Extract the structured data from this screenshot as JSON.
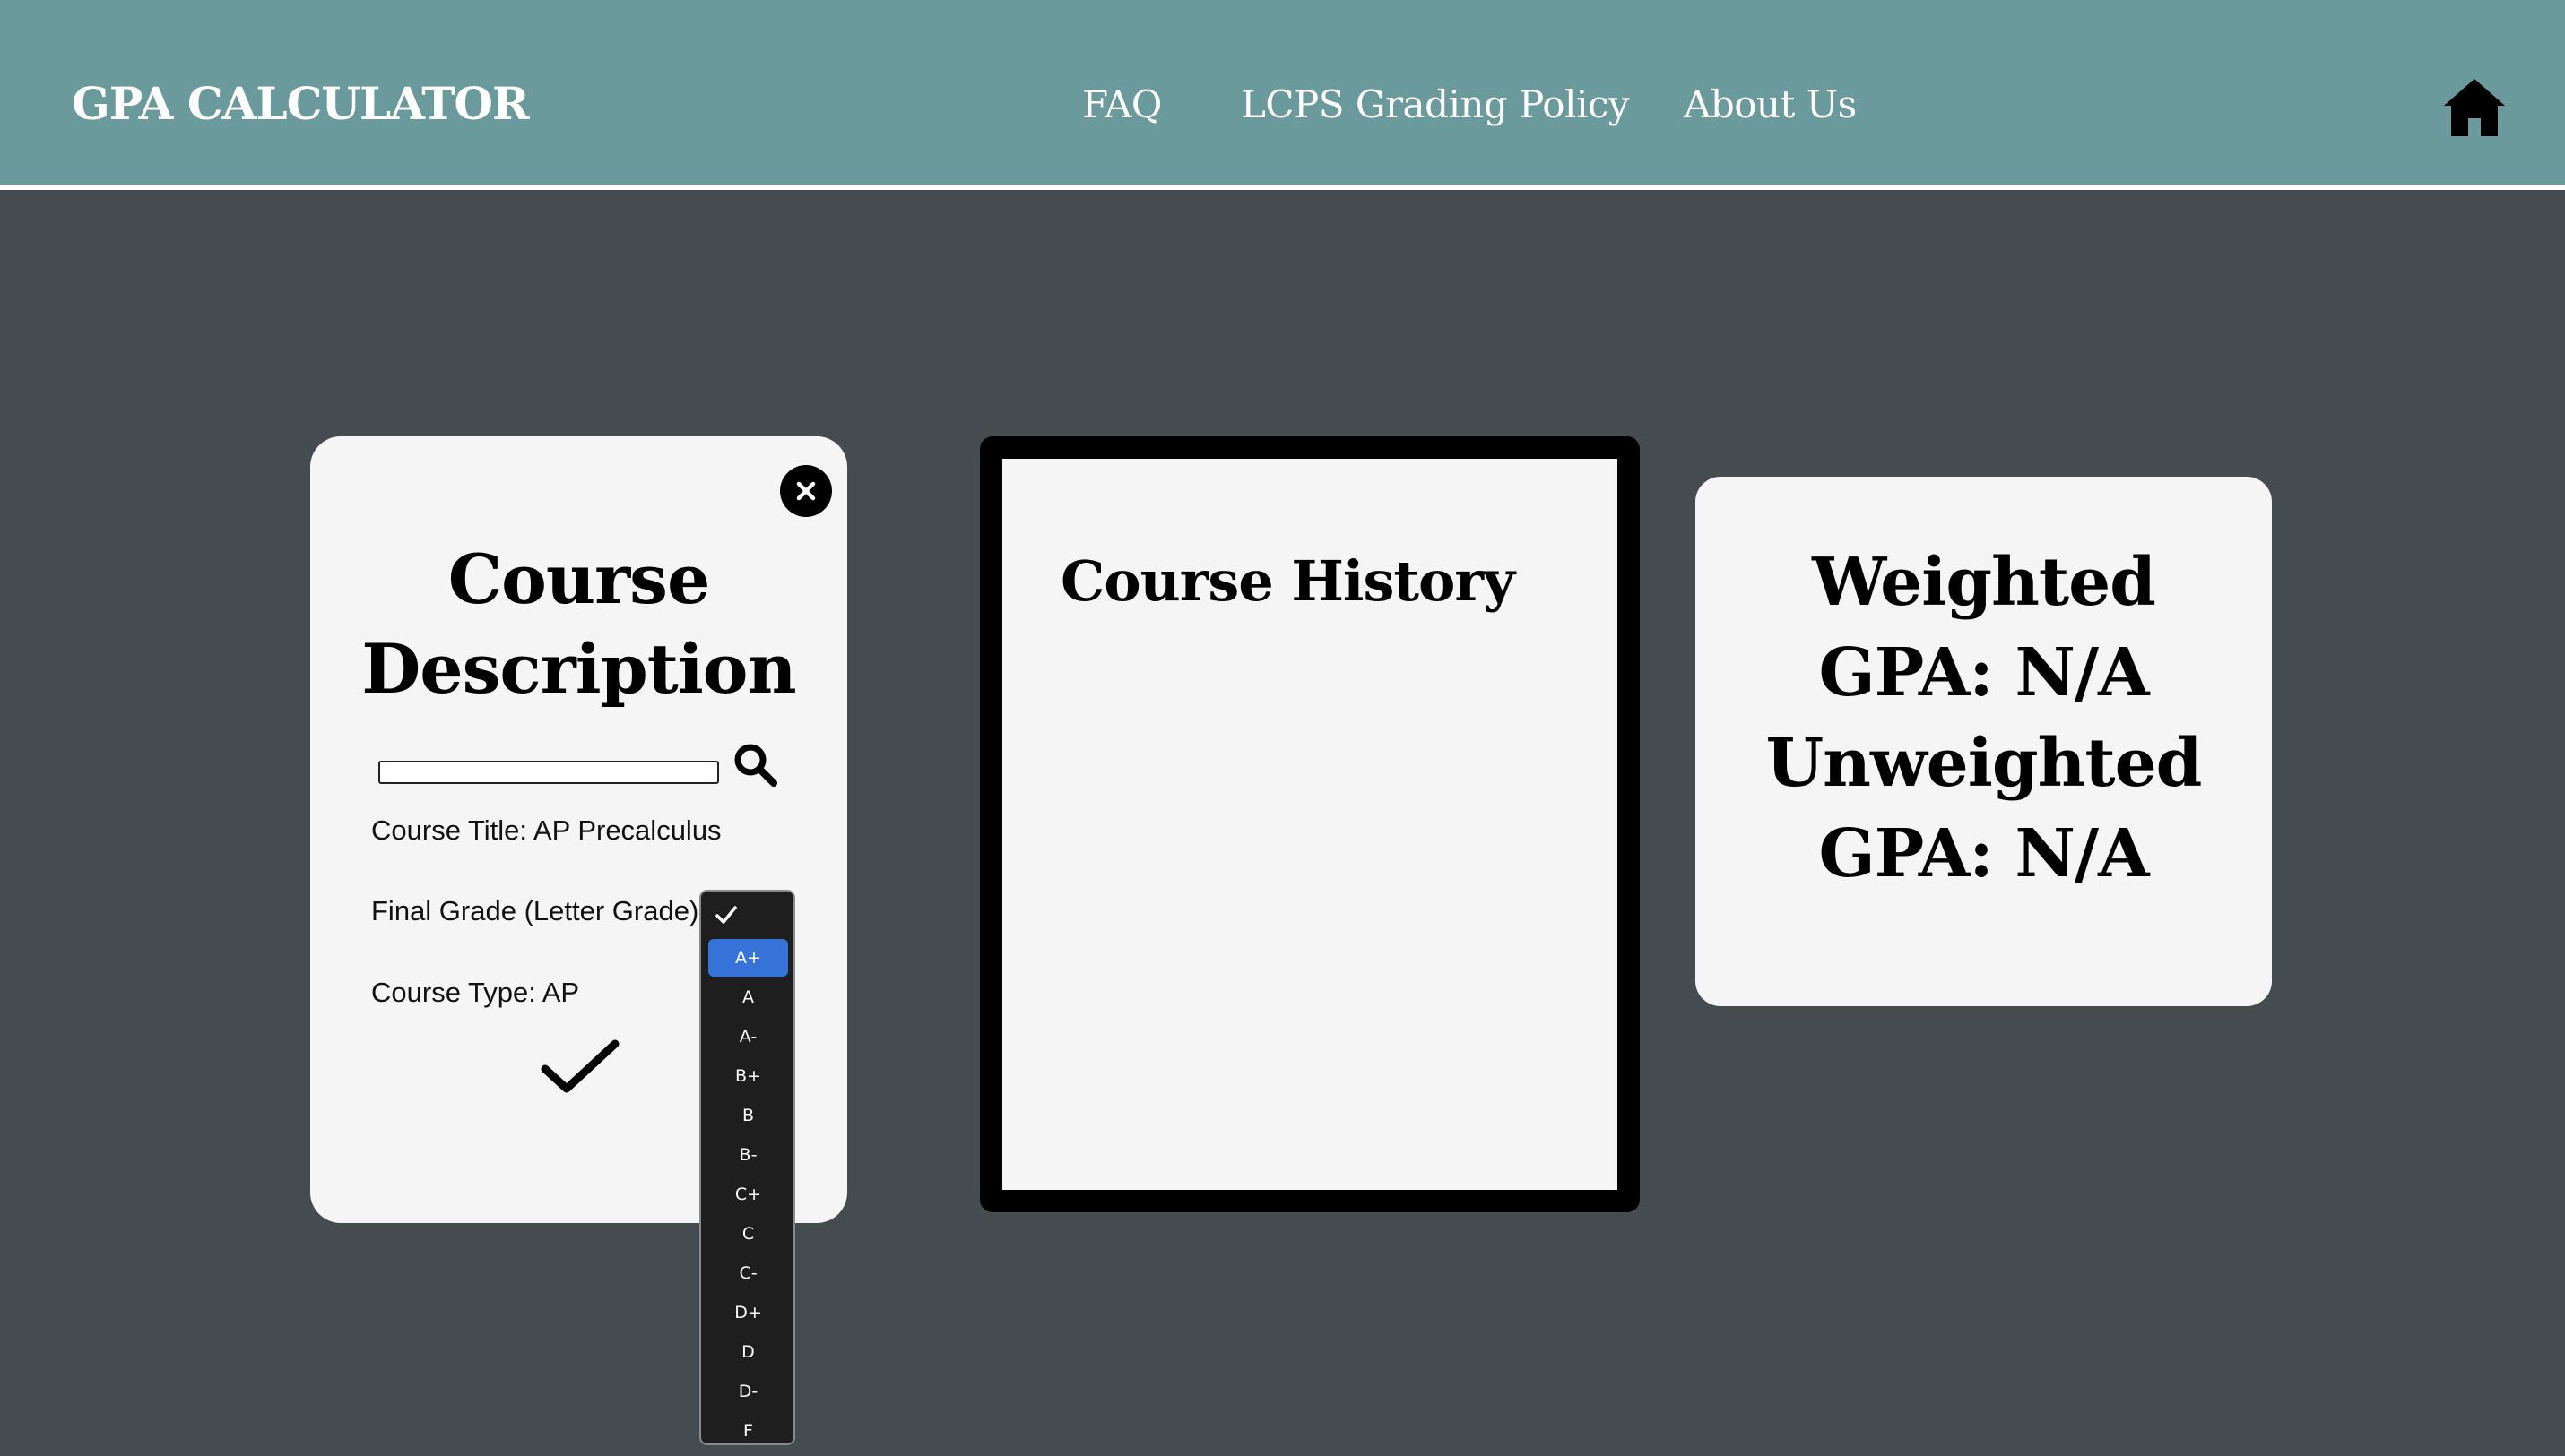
{
  "header": {
    "brand": "GPA CALCULATOR",
    "nav": [
      {
        "label": "FAQ"
      },
      {
        "label": "LCPS Grading Policy"
      },
      {
        "label": "About Us"
      }
    ],
    "home_icon": "home-icon",
    "background_color": "#6a9a9b"
  },
  "course_description": {
    "title_line1": "Course",
    "title_line2": "Description",
    "search": {
      "value": "",
      "placeholder": "",
      "icon": "search-icon"
    },
    "course_title_label": "Course Title: AP Precalculus",
    "final_grade_label": "Final Grade (Letter Grade)",
    "course_type_label": "Course Type: AP",
    "close_icon": "close-icon",
    "submit_icon": "checkmark-icon"
  },
  "grade_dropdown": {
    "selected": "A+",
    "options": [
      "A+",
      "A",
      "A-",
      "B+",
      "B",
      "B-",
      "C+",
      "C",
      "C-",
      "D+",
      "D",
      "D-",
      "F"
    ],
    "highlight_color": "#3573d9"
  },
  "course_history": {
    "title": "Course History"
  },
  "gpa": {
    "line1": "Weighted",
    "line2": "GPA: N/A",
    "line3": "Unweighted",
    "line4": "GPA: N/A"
  },
  "colors": {
    "page_background": "#444c50",
    "card_background": "#f5f5f5"
  }
}
